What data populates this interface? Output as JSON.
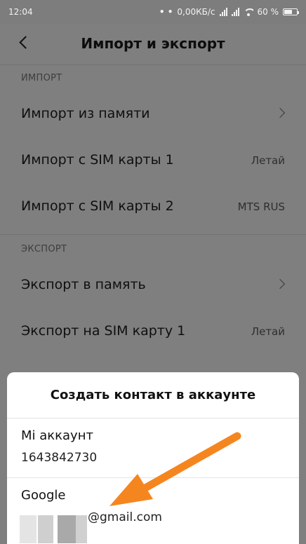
{
  "status_bar": {
    "time": "12:04",
    "notification_dots": "• •",
    "network_speed": "0,00КБ/с",
    "battery_percent": "60 %"
  },
  "header": {
    "title": "Импорт и экспорт",
    "back_icon": "chevron-left-icon"
  },
  "import_section": {
    "heading": "ИМПОРТ",
    "items": [
      {
        "label": "Импорт из памяти",
        "value": ""
      },
      {
        "label": "Импорт с SIM карты 1",
        "value": "Летай"
      },
      {
        "label": "Импорт с SIM карты 2",
        "value": "MTS RUS"
      }
    ]
  },
  "export_section": {
    "heading": "ЭКСПОРТ",
    "items": [
      {
        "label": "Экспорт в память",
        "value": ""
      },
      {
        "label": "Экспорт на SIM карту 1",
        "value": "Летай"
      }
    ]
  },
  "dialog": {
    "title": "Создать контакт в аккаунте",
    "accounts": [
      {
        "name": "Mi аккаунт",
        "detail": "1643842730"
      },
      {
        "name": "Google",
        "detail": "@gmail.com"
      }
    ]
  },
  "colors": {
    "dim_overlay": "#7f7f7f",
    "dialog_bg": "#ffffff",
    "annotation_arrow": "#f5861f"
  }
}
